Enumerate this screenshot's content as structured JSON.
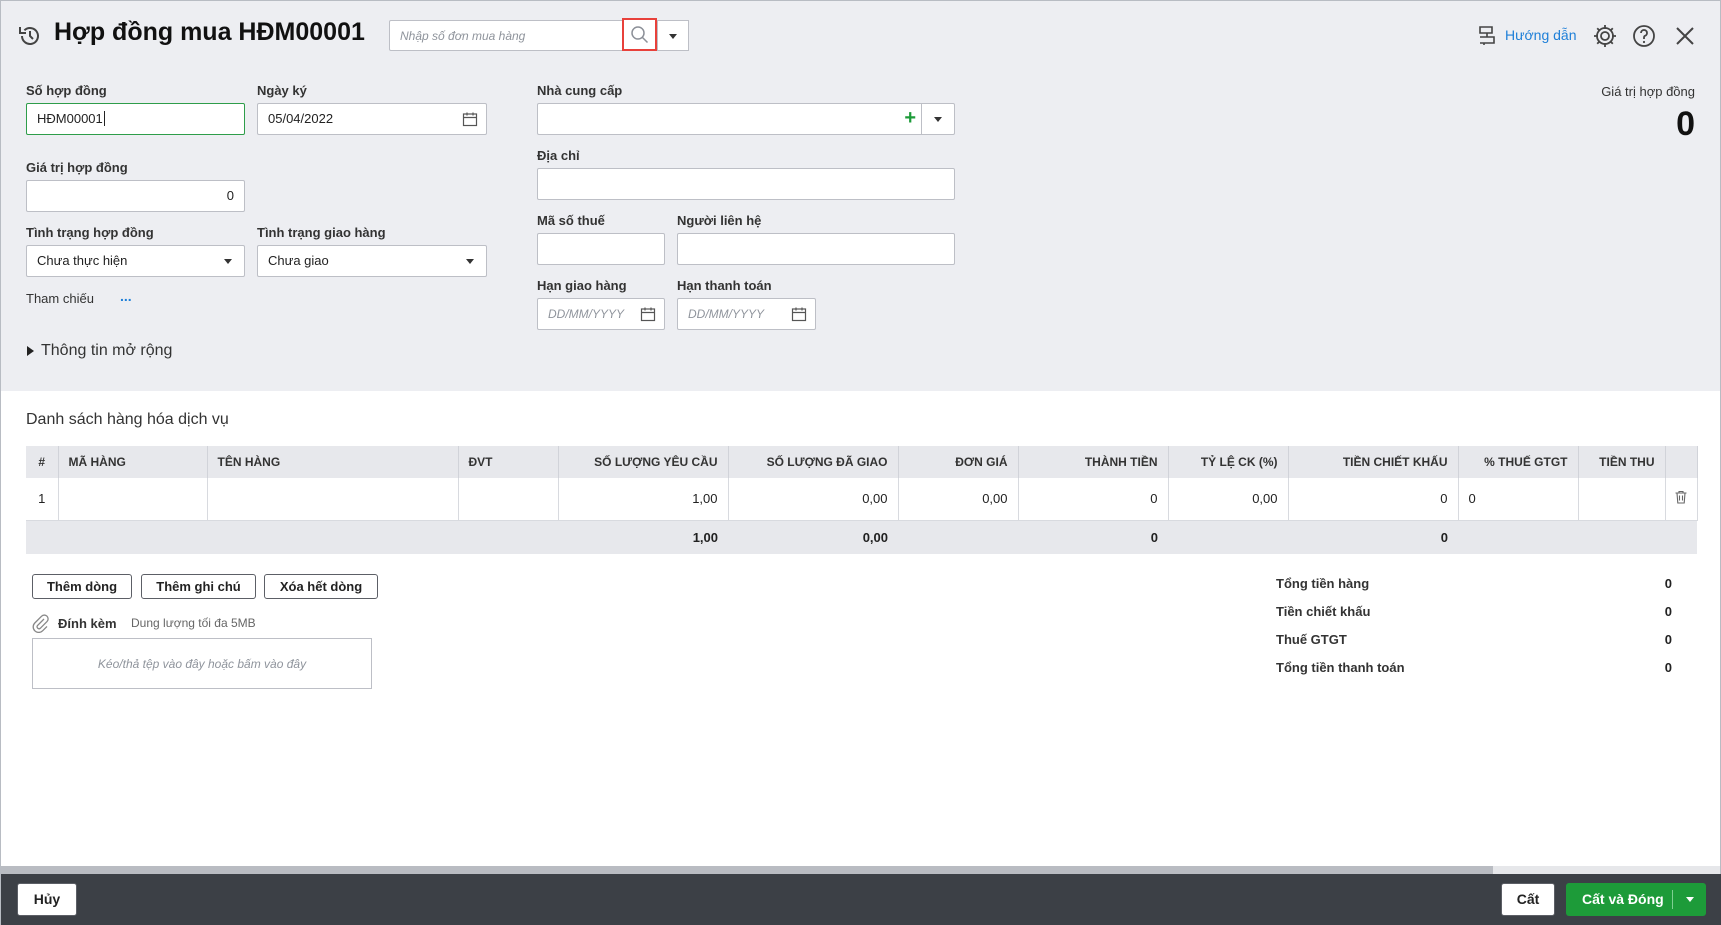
{
  "header": {
    "title": "Hợp đồng mua HĐM00001",
    "search_placeholder": "Nhập số đơn mua hàng",
    "guide_label": "Hướng dẫn"
  },
  "form": {
    "contract_no_label": "Số hợp đồng",
    "contract_no_value": "HĐM00001",
    "sign_date_label": "Ngày ký",
    "sign_date_value": "05/04/2022",
    "contract_value_label": "Giá trị hợp đồng",
    "contract_value_value": "0",
    "contract_status_label": "Tình trạng hợp đồng",
    "contract_status_value": "Chưa thực hiện",
    "delivery_status_label": "Tình trạng giao hàng",
    "delivery_status_value": "Chưa giao",
    "reference_label": "Tham chiếu",
    "reference_more": "...",
    "extended_info_label": "Thông tin mở rộng",
    "supplier_label": "Nhà cung cấp",
    "address_label": "Địa chỉ",
    "tax_code_label": "Mã số thuế",
    "contact_label": "Người liên hệ",
    "delivery_deadline_label": "Hạn giao hàng",
    "payment_deadline_label": "Hạn thanh toán",
    "date_placeholder": "DD/MM/YYYY",
    "summary_label": "Giá trị hợp đồng",
    "summary_value": "0"
  },
  "grid": {
    "section_title": "Danh sách hàng hóa dịch vụ",
    "columns": [
      "#",
      "MÃ HÀNG",
      "TÊN HÀNG",
      "ĐVT",
      "SỐ LƯỢNG YÊU CẦU",
      "SỐ LƯỢNG ĐÃ GIAO",
      "ĐƠN GIÁ",
      "THÀNH TIỀN",
      "TỶ LỆ CK (%)",
      "TIỀN CHIẾT KHẤU",
      "% THUẾ GTGT",
      "TIỀN THU"
    ],
    "rows": [
      [
        "1",
        "",
        "",
        "",
        "1,00",
        "0,00",
        "0,00",
        "0",
        "0,00",
        "0",
        "0",
        ""
      ]
    ],
    "sum": [
      "",
      "",
      "",
      "",
      "1,00",
      "0,00",
      "",
      "0",
      "",
      "0",
      "",
      ""
    ]
  },
  "actions": {
    "add_row": "Thêm dòng",
    "add_note": "Thêm ghi chú",
    "delete_all": "Xóa hết dòng",
    "attach_label": "Đính kèm",
    "attach_limit": "Dung lượng tối đa 5MB",
    "drop_hint": "Kéo/thả tệp vào đây hoặc bấm vào đây"
  },
  "totals": [
    {
      "label": "Tổng tiền hàng",
      "value": "0"
    },
    {
      "label": "Tiền chiết khấu",
      "value": "0"
    },
    {
      "label": "Thuế GTGT",
      "value": "0"
    },
    {
      "label": "Tổng tiền thanh toán",
      "value": "0"
    }
  ],
  "footer": {
    "cancel": "Hủy",
    "save": "Cất",
    "save_close": "Cất và Đóng"
  },
  "colors": {
    "accent": "#1e7fd8",
    "primary_button": "#1d9b39",
    "focus_border": "#2e9d4a",
    "highlight": "#e8413b"
  }
}
